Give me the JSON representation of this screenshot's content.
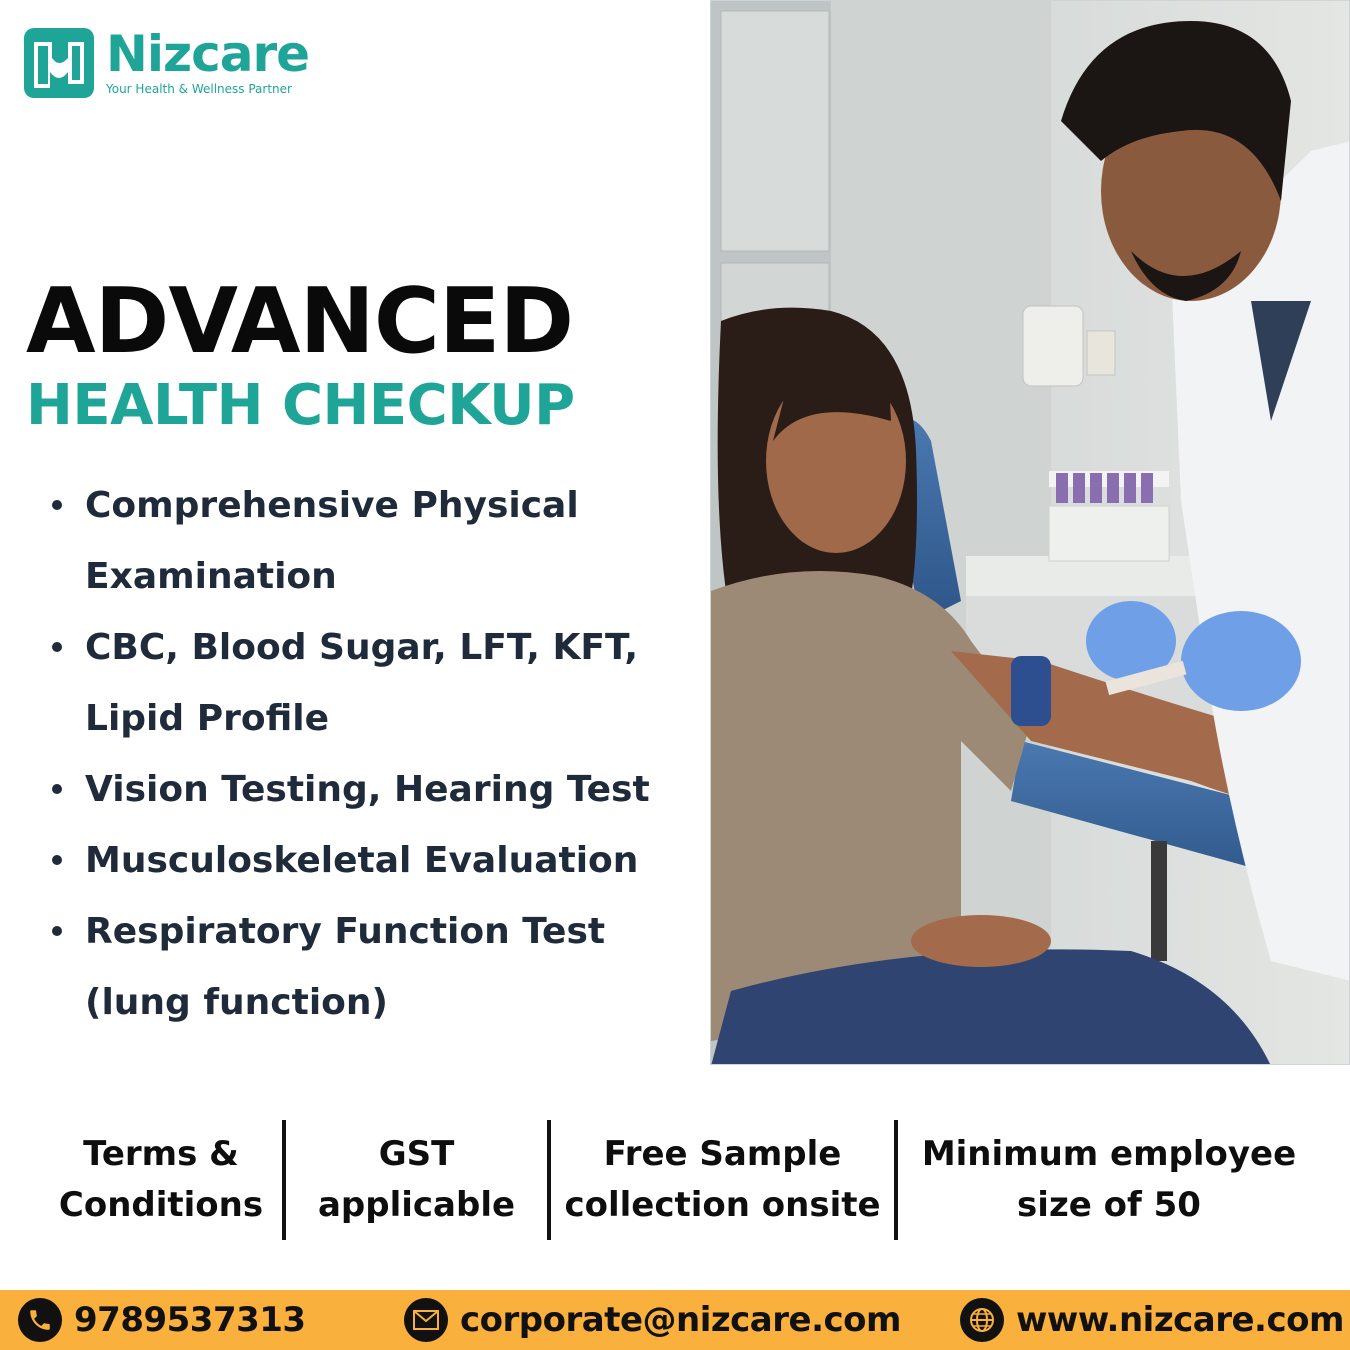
{
  "brand": {
    "name": "Nizcare",
    "tagline": "Your Health & Wellness Partner",
    "color": "#1fa598"
  },
  "headline": {
    "line1": "ADVANCED",
    "line2": "HEALTH CHECKUP"
  },
  "features": [
    " Comprehensive Physical Examination",
    "CBC, Blood Sugar, LFT, KFT, Lipid Profile",
    "Vision Testing, Hearing Test",
    "Musculoskeletal Evaluation",
    "Respiratory Function Test (lung function)"
  ],
  "info": [
    "Terms & Conditions",
    "GST applicable",
    "Free Sample collection onsite",
    "Minimum employee size of 50"
  ],
  "contact": {
    "phone": "9789537313",
    "email": "corporate@nizcare.com",
    "website": "www.nizcare.com",
    "bar_color": "#f9b03c"
  },
  "icons": {
    "phone": "phone-icon",
    "email": "envelope-icon",
    "website": "globe-icon"
  }
}
